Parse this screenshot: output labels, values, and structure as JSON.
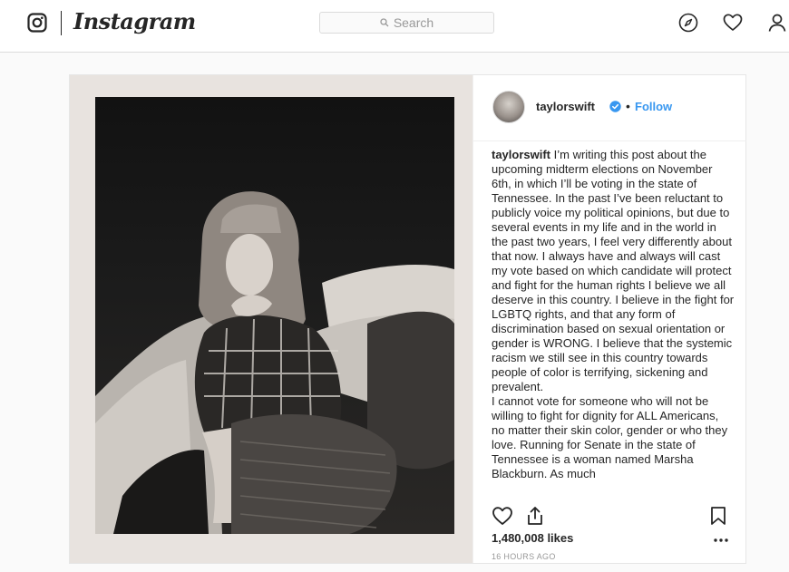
{
  "nav": {
    "brand": "Instagram",
    "search_placeholder": "Search",
    "icons": [
      "instagram-glyph-icon",
      "compass-icon",
      "heart-icon",
      "profile-icon"
    ]
  },
  "post": {
    "username": "taylorswift",
    "verified": true,
    "follow_label": "Follow",
    "caption_user": "taylorswift",
    "caption_text": " I’m writing this post about the upcoming midterm elections on November 6th, in which I’ll be voting in the state of Tennessee. In the past I’ve been reluctant to publicly voice my political opinions, but due to several events in my life and in the world in the past two years, I feel very differently about that now. I always have and always will cast my vote based on which candidate will protect and fight for the human rights I believe we all deserve in this country. I believe in the fight for LGBTQ rights, and that any form of discrimination based on sexual orientation or gender is WRONG. I believe that the systemic racism we still see in this country towards people of color is terrifying, sickening and prevalent.\nI cannot vote for someone who will not be willing to fight for dignity for ALL Americans, no matter their skin color, gender or who they love. Running for Senate in the state of Tennessee is a woman named Marsha Blackburn. As much",
    "likes": "1,480,008 likes",
    "timestamp": "16 HOURS AGO"
  },
  "colors": {
    "accent": "#3897f0",
    "text": "#262626",
    "muted": "#999999",
    "border": "#dbdbdb",
    "background": "#fafafa"
  }
}
